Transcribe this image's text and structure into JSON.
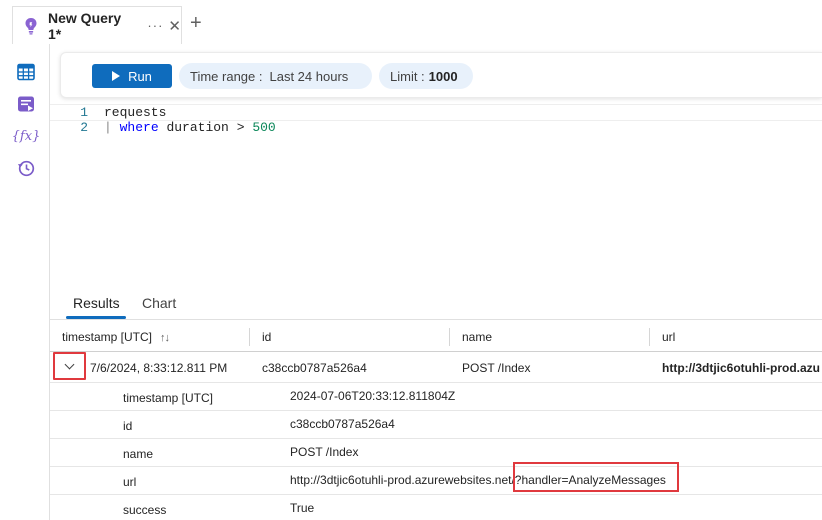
{
  "tab": {
    "title": "New Query 1*",
    "more": "···",
    "close": "✕",
    "add": "+"
  },
  "rail": {
    "icons": [
      "table-icon",
      "query-pack-icon",
      "function-icon",
      "history-icon"
    ],
    "function_label": "{fx}"
  },
  "toolbar": {
    "run_label": "Run",
    "time_range_label": "Time range :",
    "time_range_value": "Last 24 hours",
    "limit_label": "Limit :",
    "limit_value": "1000"
  },
  "editor": {
    "lines": [
      {
        "number": "1",
        "text": "requests"
      },
      {
        "number": "2",
        "pipe": "|",
        "keyword": "where",
        "field": "duration",
        "op": ">",
        "value": "500"
      }
    ]
  },
  "results": {
    "tabs": [
      "Results",
      "Chart"
    ],
    "active_tab": "Results",
    "columns": [
      "timestamp [UTC]",
      "id",
      "name",
      "url"
    ],
    "row": {
      "timestamp": "7/6/2024, 8:33:12.811 PM",
      "id": "c38ccb0787a526a4",
      "name": "POST /Index",
      "url": "http://3dtjic6otuhli-prod.azu"
    },
    "details": [
      {
        "key": "timestamp [UTC]",
        "value": "2024-07-06T20:33:12.811804Z"
      },
      {
        "key": "id",
        "value": "c38ccb0787a526a4"
      },
      {
        "key": "name",
        "value": "POST /Index"
      },
      {
        "key": "url",
        "value": "http://3dtjic6otuhli-prod.azurewebsites.net/?handler=AnalyzeMessages"
      },
      {
        "key": "success",
        "value": "True"
      }
    ]
  },
  "colors": {
    "accent": "#0f6cbd",
    "highlight": "#e0393e",
    "pill": "#e8f1fb"
  }
}
